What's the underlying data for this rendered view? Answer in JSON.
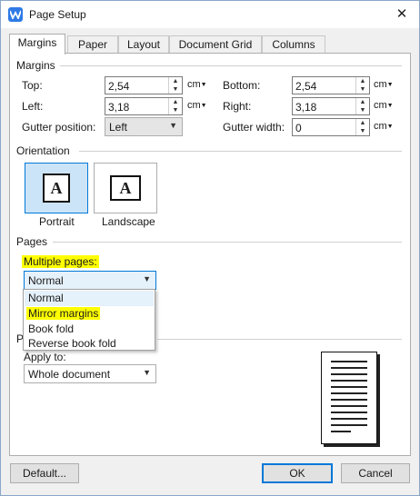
{
  "window": {
    "title": "Page Setup",
    "close_glyph": "✕"
  },
  "tabs": [
    {
      "label": "Margins",
      "active": true
    },
    {
      "label": "Paper"
    },
    {
      "label": "Layout"
    },
    {
      "label": "Document Grid"
    },
    {
      "label": "Columns"
    }
  ],
  "margins": {
    "title": "Margins",
    "top": {
      "label": "Top:",
      "value": "2,54",
      "unit": "cm"
    },
    "bottom": {
      "label": "Bottom:",
      "value": "2,54",
      "unit": "cm"
    },
    "left": {
      "label": "Left:",
      "value": "3,18",
      "unit": "cm"
    },
    "right": {
      "label": "Right:",
      "value": "3,18",
      "unit": "cm"
    },
    "gutter_position": {
      "label": "Gutter position:",
      "value": "Left"
    },
    "gutter_width": {
      "label": "Gutter width:",
      "value": "0",
      "unit": "cm"
    }
  },
  "orientation": {
    "title": "Orientation",
    "portrait": {
      "label": "Portrait",
      "glyph": "A",
      "selected": true
    },
    "landscape": {
      "label": "Landscape",
      "glyph": "A"
    }
  },
  "pages": {
    "title": "Pages",
    "multiple_pages_label": "Multiple pages:",
    "multiple_pages_value": "Normal",
    "options": [
      "Normal",
      "Mirror margins",
      "Book fold",
      "Reverse book fold"
    ]
  },
  "preview": {
    "title_partial": "P",
    "apply_to_label": "Apply to:",
    "apply_to_value": "Whole document"
  },
  "buttons": {
    "default": "Default...",
    "ok": "OK",
    "cancel": "Cancel"
  },
  "colors": {
    "highlight": "#ffff00",
    "accent": "#0078d7"
  }
}
